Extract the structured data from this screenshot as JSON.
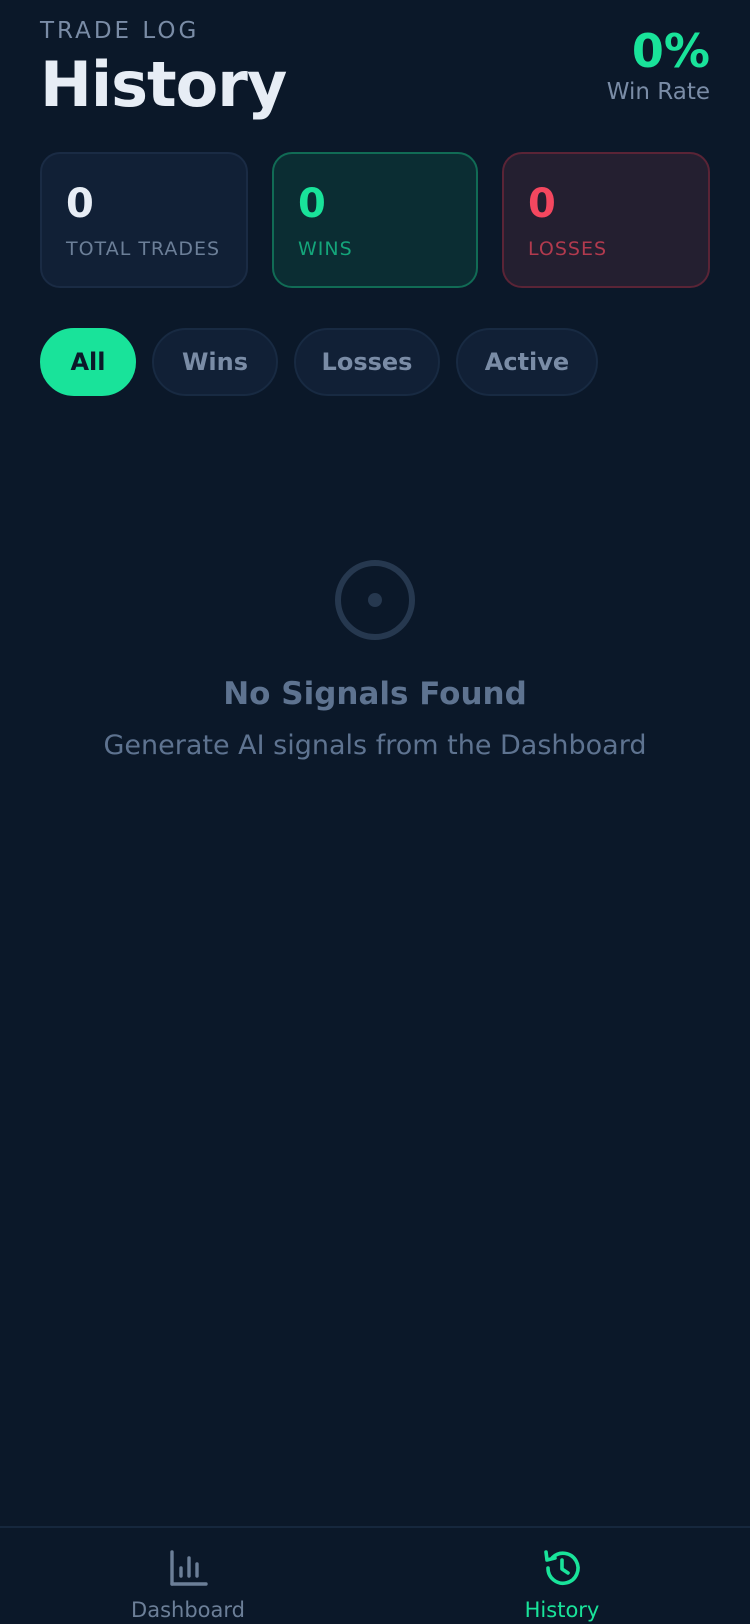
{
  "header": {
    "eyebrow": "TRADE LOG",
    "title": "History",
    "win_rate_value": "0%",
    "win_rate_label": "Win Rate"
  },
  "stats": {
    "total": {
      "value": "0",
      "label": "TOTAL TRADES"
    },
    "wins": {
      "value": "0",
      "label": "WINS"
    },
    "losses": {
      "value": "0",
      "label": "LOSSES"
    }
  },
  "filters": {
    "selected": "All",
    "items": [
      {
        "label": "All"
      },
      {
        "label": "Wins"
      },
      {
        "label": "Losses"
      },
      {
        "label": "Active"
      }
    ]
  },
  "empty_state": {
    "icon": "target-icon",
    "title": "No Signals Found",
    "subtitle": "Generate AI signals from the Dashboard"
  },
  "tabbar": {
    "active": "History",
    "items": [
      {
        "label": "Dashboard",
        "icon": "bar-chart-icon"
      },
      {
        "label": "History",
        "icon": "history-icon"
      }
    ]
  },
  "colors": {
    "background": "#0b1829",
    "accent": "#19e39a",
    "loss": "#f4475f",
    "muted": "#7a8ca6"
  }
}
